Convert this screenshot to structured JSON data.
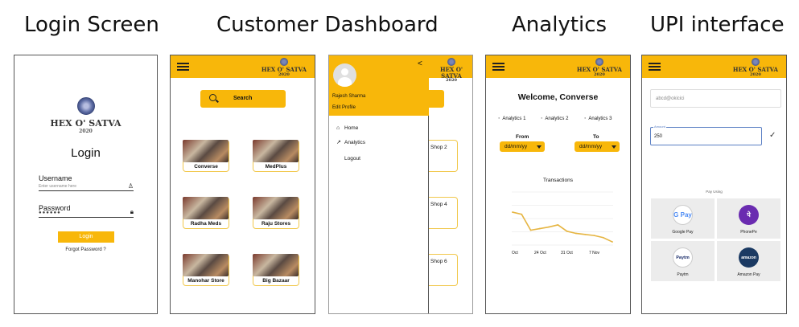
{
  "headings": {
    "login": "Login Screen",
    "dashboard": "Customer Dashboard",
    "analytics": "Analytics",
    "upi": "UPI interface"
  },
  "brand": {
    "name": "HEX O' SATVA",
    "year": "2020"
  },
  "login": {
    "title": "Login",
    "username_label": "Username",
    "username_placeholder": "Enter username here",
    "password_label": "Password",
    "password_mask": "●●●●●●",
    "login_button": "Login",
    "forgot": "Forgot Password ?"
  },
  "dashboard": {
    "search_label": "Search",
    "shops": [
      "Converse",
      "MedPlus",
      "Radha Meds",
      "Raju Stores",
      "Manohar Store",
      "Big Bazaar"
    ]
  },
  "drawer": {
    "user_name": "Rajesh Sharma",
    "edit_profile": "Edit Profile",
    "back_glyph": "<",
    "menu": [
      "Home",
      "Analytics",
      "Logout"
    ],
    "behind_shops": [
      "Shop 2",
      "Shop 4",
      "Shop 6"
    ]
  },
  "analytics": {
    "welcome": "Welcome, Converse",
    "links": [
      "Analytics 1",
      "Analytics 2",
      "Analytics 3"
    ],
    "from_label": "From",
    "to_label": "To",
    "from_value": "dd/mm/yy",
    "to_value": "dd/mm/yy",
    "chart_title": "Transactions",
    "x_ticks": [
      "Oct",
      "24 Oct",
      "31 Oct",
      "7 Nov"
    ]
  },
  "chart_data": {
    "type": "line",
    "title": "Transactions",
    "x": [
      "Oct",
      "",
      "",
      "",
      "24 Oct",
      "",
      "",
      "31 Oct",
      "",
      "",
      "7 Nov",
      ""
    ],
    "series": [
      {
        "values": [
          62,
          58,
          28,
          31,
          34,
          38,
          26,
          22,
          20,
          18,
          14,
          6
        ]
      }
    ],
    "ylim": [
      0,
      100
    ],
    "color": "#e6b542",
    "grid": true
  },
  "upi": {
    "upi_id_placeholder": "abcd@okicici",
    "amount_label": "Amount",
    "amount_value": "250",
    "pay_using": "Pay Using",
    "apps": [
      {
        "name": "Google Pay",
        "glyph": "G Pay",
        "color": "#4a8af4"
      },
      {
        "name": "PhonePe",
        "glyph": "पे",
        "color": "#6a2bb0"
      },
      {
        "name": "Paytm",
        "glyph": "Paytm",
        "color": "#1b2e6b"
      },
      {
        "name": "Amazon Pay",
        "glyph": "amazon",
        "color": "#1b3a63"
      }
    ]
  },
  "colors": {
    "accent": "#f8b70a",
    "focus": "#5a7fc4"
  }
}
